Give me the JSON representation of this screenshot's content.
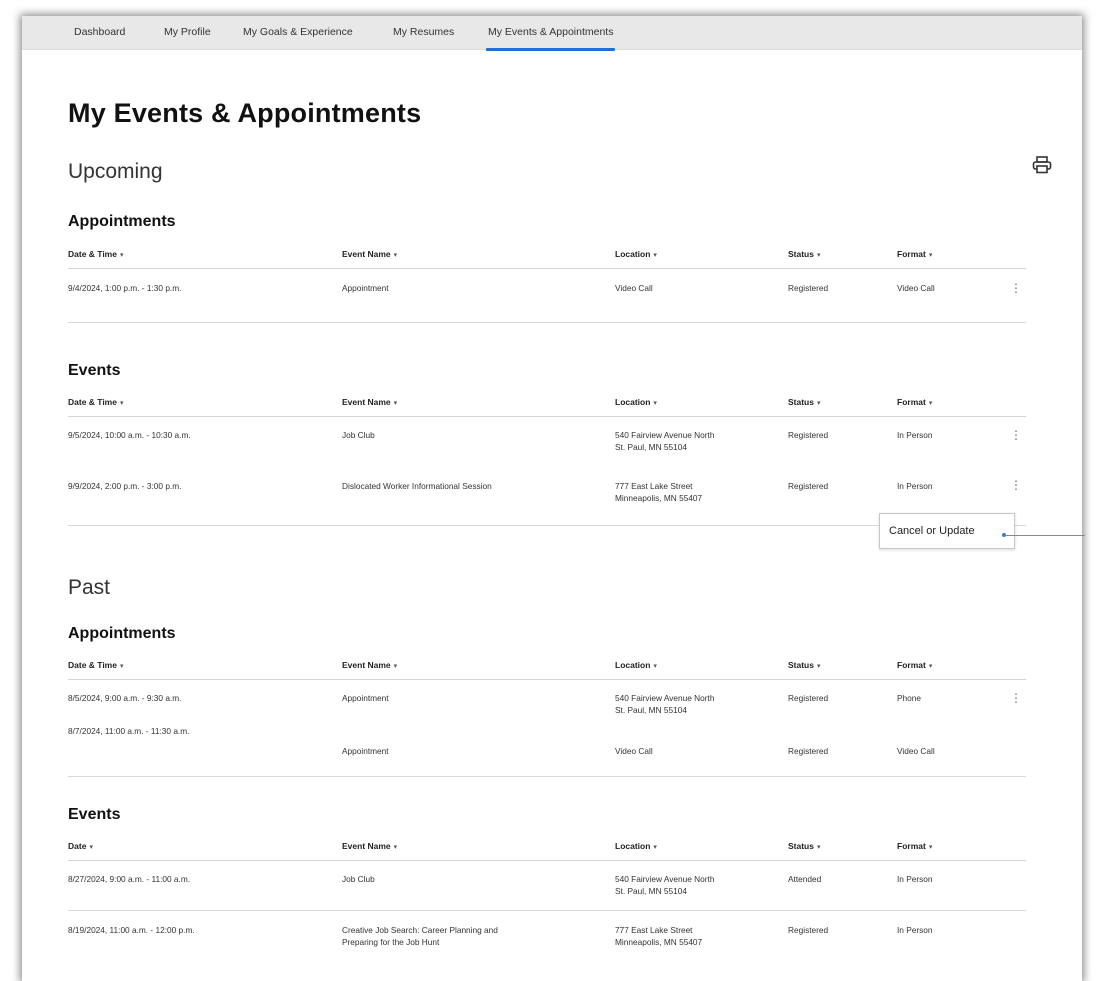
{
  "nav": {
    "tabs": [
      {
        "label": "Dashboard"
      },
      {
        "label": "My Profile"
      },
      {
        "label": "My Goals & Experience"
      },
      {
        "label": "My Resumes"
      },
      {
        "label": "My Events & Appointments"
      }
    ],
    "active": "My Events & Appointments"
  },
  "page": {
    "title": "My Events & Appointments",
    "print_icon": "printer-icon"
  },
  "upcoming": {
    "heading": "Upcoming",
    "appointments": {
      "heading": "Appointments",
      "columns": [
        "Date & Time",
        "Event Name",
        "Location",
        "Status",
        "Format"
      ],
      "rows": [
        {
          "date": "9/4/2024, 1:00 p.m. - 1:30 p.m.",
          "name": "Appointment",
          "loc1": "Video Call",
          "loc2": "",
          "status": "Registered",
          "format": "Video Call"
        }
      ]
    },
    "events": {
      "heading": "Events",
      "columns": [
        "Date & Time",
        "Event Name",
        "Location",
        "Status",
        "Format"
      ],
      "rows": [
        {
          "date": "9/5/2024, 10:00 a.m. - 10:30 a.m.",
          "name": "Job Club",
          "loc1": "540 Fairview Avenue North",
          "loc2": "St. Paul, MN 55104",
          "status": "Registered",
          "format": "In Person"
        },
        {
          "date": "9/9/2024, 2:00 p.m. - 3:00 p.m.",
          "name": "Dislocated Worker Informational Session",
          "loc1": "777 East Lake Street",
          "loc2": "Minneapolis, MN 55407",
          "status": "Registered",
          "format": "In Person"
        }
      ]
    },
    "menu_option": "Cancel or Update"
  },
  "past": {
    "heading": "Past",
    "appointments": {
      "heading": "Appointments",
      "columns": [
        "Date & Time",
        "Event Name",
        "Location",
        "Status",
        "Format"
      ],
      "rows": [
        {
          "date": "8/5/2024, 9:00 a.m. - 9:30 a.m.",
          "name": "Appointment",
          "loc1": "540 Fairview Avenue North",
          "loc2": "St. Paul, MN 55104",
          "status": "Registered",
          "format": "Phone"
        },
        {
          "date": "8/7/2024, 11:00 a.m. - 11:30 a.m.",
          "name": "Appointment",
          "loc1": "Video Call",
          "loc2": "",
          "status": "Registered",
          "format": "Video Call"
        }
      ]
    },
    "events": {
      "heading": "Events",
      "columns": [
        "Date",
        "Event Name",
        "Location",
        "Status",
        "Format"
      ],
      "rows": [
        {
          "date": "8/27/2024, 9:00 a.m. - 11:00 a.m.",
          "name": "Job Club",
          "name2": "",
          "loc1": "540 Fairview Avenue North",
          "loc2": "St. Paul, MN 55104",
          "status": "Attended",
          "format": "In Person"
        },
        {
          "date": "8/19/2024, 11:00 a.m. - 12:00 p.m.",
          "name": "Creative Job Search: Career Planning and",
          "name2": "Preparing for the Job Hunt",
          "loc1": "777 East Lake Street",
          "loc2": "Minneapolis, MN 55407",
          "status": "Registered",
          "format": "In Person"
        }
      ]
    }
  }
}
